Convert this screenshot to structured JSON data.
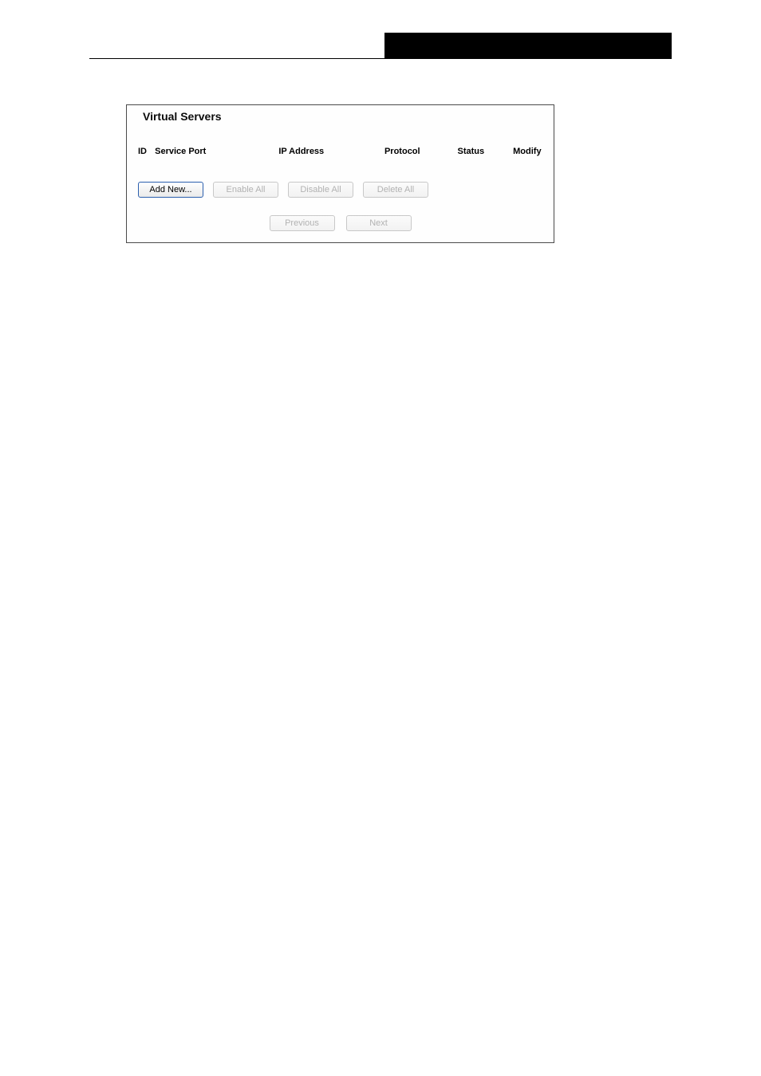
{
  "panel": {
    "title": "Virtual Servers",
    "columns": {
      "id": "ID",
      "servicePort": "Service Port",
      "ipAddress": "IP Address",
      "protocol": "Protocol",
      "status": "Status",
      "modify": "Modify"
    },
    "buttons": {
      "addNew": "Add New...",
      "enableAll": "Enable All",
      "disableAll": "Disable All",
      "deleteAll": "Delete All",
      "previous": "Previous",
      "next": "Next"
    }
  }
}
